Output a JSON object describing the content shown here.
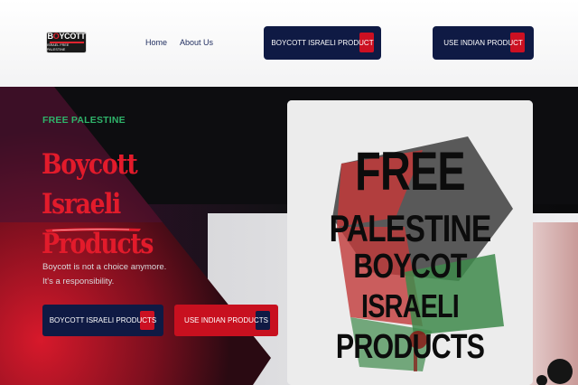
{
  "header": {
    "logo": {
      "line1_pre": "B",
      "line1_o": "O",
      "line1_post": "YCOTT",
      "line2": "ISRAEL FREE PALESTINE"
    },
    "nav": [
      {
        "label": "Home"
      },
      {
        "label": "About Us"
      }
    ],
    "buttons": [
      {
        "label": "BOYCOTT ISRAELI PRODUCT"
      },
      {
        "label": "USE INDIAN PRODUCT"
      }
    ]
  },
  "hero": {
    "eyebrow": "FREE PALESTINE",
    "title_line1": "Boycott Israeli",
    "title_line2": "Products",
    "desc_line1": "Boycott is not a choice anymore.",
    "desc_line2": "It's a responsibility.",
    "buttons": [
      {
        "label": "BOYCOTT ISRAELI PRODUCTS"
      },
      {
        "label": "USE INDIAN PRODUCTS"
      }
    ]
  },
  "poster": {
    "lines": [
      "FREE",
      "PALESTINE",
      "BOYCOT",
      "ISRAELI",
      "PRODUCTS"
    ]
  },
  "colors": {
    "navy": "#0f1a44",
    "red": "#cc1022",
    "green": "#2fb36a",
    "title_red": "#e21b2b"
  }
}
